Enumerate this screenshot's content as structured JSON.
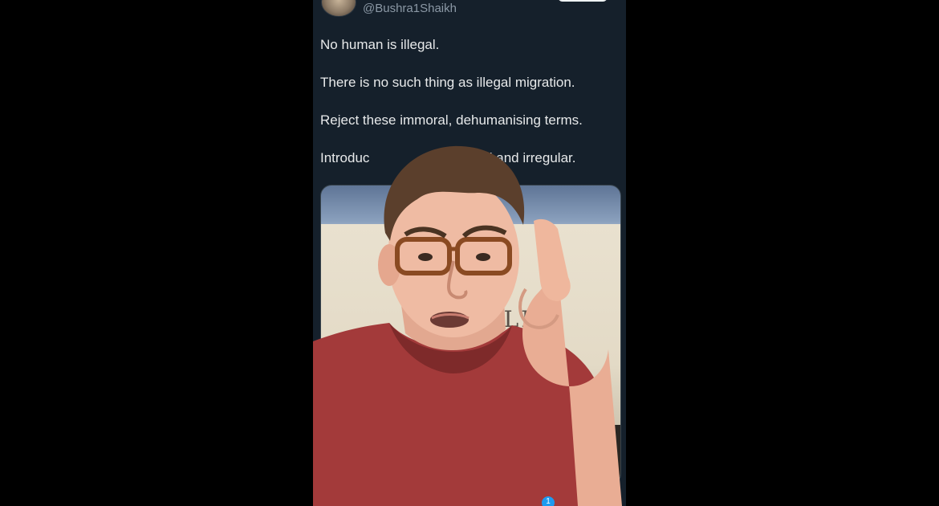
{
  "tweet": {
    "handle": "@Bushra1Shaikh",
    "lines": [
      "No human is illegal.",
      "There is no such thing as illegal migration.",
      "Reject these immoral, dehumanising terms.",
      "Introduce undocumented and irregular."
    ],
    "visible_line_4_left": "Introduc",
    "visible_line_4_right": "nted and irregular."
  },
  "media": {
    "sign_text": "ILLE"
  },
  "overlay": {
    "notification_count": "1"
  },
  "colors": {
    "background": "#000000",
    "tweet_bg": "#15202b",
    "text_primary": "#e7e9ea",
    "text_secondary": "#8b98a5",
    "accent": "#1d9bf0",
    "shirt": "#a33a3a"
  },
  "icons": {
    "avatar": "profile-photo",
    "bottom": "notification-badge"
  }
}
